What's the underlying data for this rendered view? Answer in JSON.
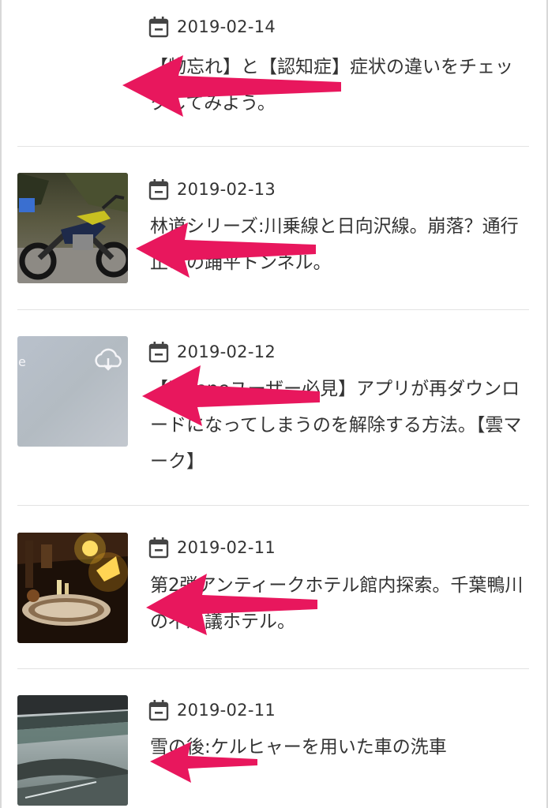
{
  "posts": [
    {
      "date": "2019-02-14",
      "title": "【物忘れ】と【認知症】症状の違いをチェックしてみよう。",
      "thumbnail": "none"
    },
    {
      "date": "2019-02-13",
      "title": "林道シリーズ:川乗線と日向沢線。崩落？通行止めの踊平トンネル。",
      "thumbnail": "motorcycle-photo"
    },
    {
      "date": "2019-02-12",
      "title": "【iPhoneユーザー必見】アプリが再ダウンロードになってしまうのを解除する方法。【雲マーク】",
      "thumbnail": "cloud-download-screenshot"
    },
    {
      "date": "2019-02-11",
      "title": "第2弾アンティークホテル館内探索。千葉鴨川の不思議ホテル。",
      "thumbnail": "antique-hotel-photo"
    },
    {
      "date": "2019-02-11",
      "title": "雪の後:ケルヒャーを用いた車の洗車",
      "thumbnail": "car-wash-photo"
    }
  ],
  "annotation": {
    "arrow_color": "#e8175d"
  }
}
